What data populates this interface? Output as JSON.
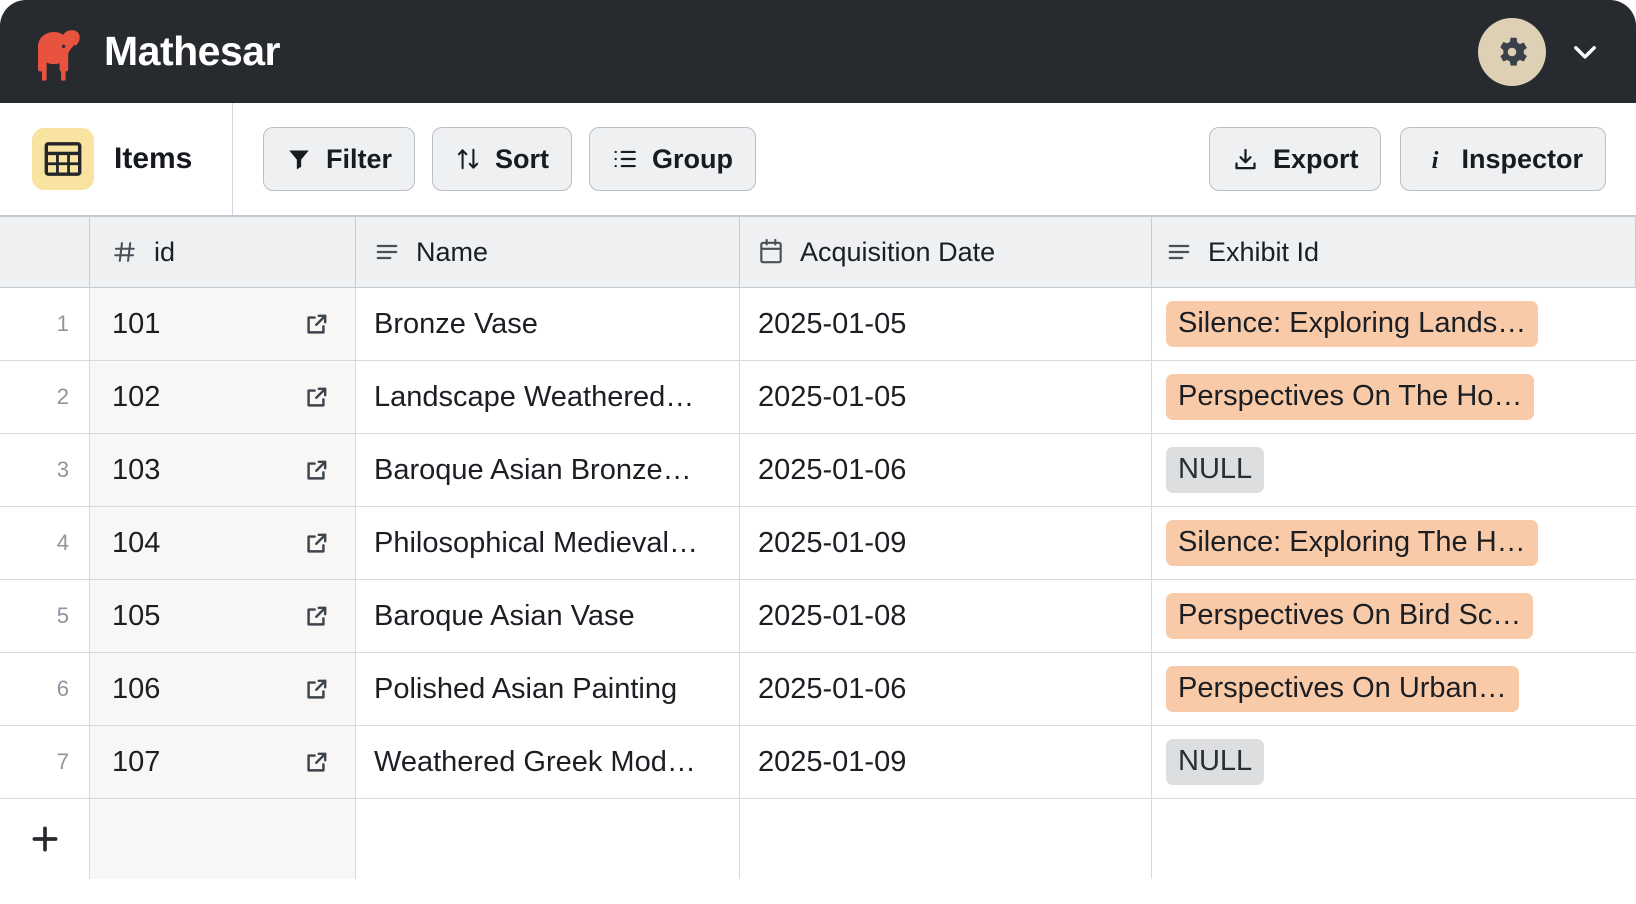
{
  "app": {
    "brand_name": "Mathesar",
    "logo_color": "#e8533f",
    "topbar_bg": "#272a2e",
    "gear_badge_color": "#ded0b4"
  },
  "topbar": {
    "settings_icon": "gear-icon",
    "chevron_icon": "chevron-down-icon"
  },
  "toolbar": {
    "table_icon": "table-grid-icon",
    "table_name": "Items",
    "table_chip_color": "#f8e3a1",
    "buttons": [
      {
        "label": "Filter",
        "icon": "funnel-icon"
      },
      {
        "label": "Sort",
        "icon": "sort-arrows-icon"
      },
      {
        "label": "Group",
        "icon": "group-list-icon"
      }
    ],
    "right_buttons": [
      {
        "label": "Export",
        "icon": "download-icon"
      },
      {
        "label": "Inspector",
        "icon": "info-icon"
      }
    ]
  },
  "table": {
    "columns": [
      {
        "label": "id",
        "type_icon": "hash-icon"
      },
      {
        "label": "Name",
        "type_icon": "text-lines-icon"
      },
      {
        "label": "Acquisition Date",
        "type_icon": "calendar-icon"
      },
      {
        "label": "Exhibit Id",
        "type_icon": "text-lines-icon"
      }
    ],
    "fk_pill_color": "#f8caa8",
    "null_pill_color": "#dcdedf",
    "rows": [
      {
        "n": "1",
        "id": "101",
        "name": "Bronze Vase",
        "date": "2025-01-05",
        "exhibit": "Silence: Exploring Lands…",
        "exhibit_null": false
      },
      {
        "n": "2",
        "id": "102",
        "name": "Landscape Weathered…",
        "date": "2025-01-05",
        "exhibit": "Perspectives On The Ho…",
        "exhibit_null": false
      },
      {
        "n": "3",
        "id": "103",
        "name": "Baroque Asian Bronze…",
        "date": "2025-01-06",
        "exhibit": "NULL",
        "exhibit_null": true
      },
      {
        "n": "4",
        "id": "104",
        "name": "Philosophical Medieval…",
        "date": "2025-01-09",
        "exhibit": "Silence: Exploring The H…",
        "exhibit_null": false
      },
      {
        "n": "5",
        "id": "105",
        "name": "Baroque Asian Vase",
        "date": "2025-01-08",
        "exhibit": "Perspectives On Bird Sc…",
        "exhibit_null": false
      },
      {
        "n": "6",
        "id": "106",
        "name": "Polished Asian Painting",
        "date": "2025-01-06",
        "exhibit": "Perspectives On Urban…",
        "exhibit_null": false
      },
      {
        "n": "7",
        "id": "107",
        "name": "Weathered Greek Mod…",
        "date": "2025-01-09",
        "exhibit": "NULL",
        "exhibit_null": true
      }
    ],
    "link_icon": "external-link-icon",
    "add_row_icon": "plus-icon"
  }
}
